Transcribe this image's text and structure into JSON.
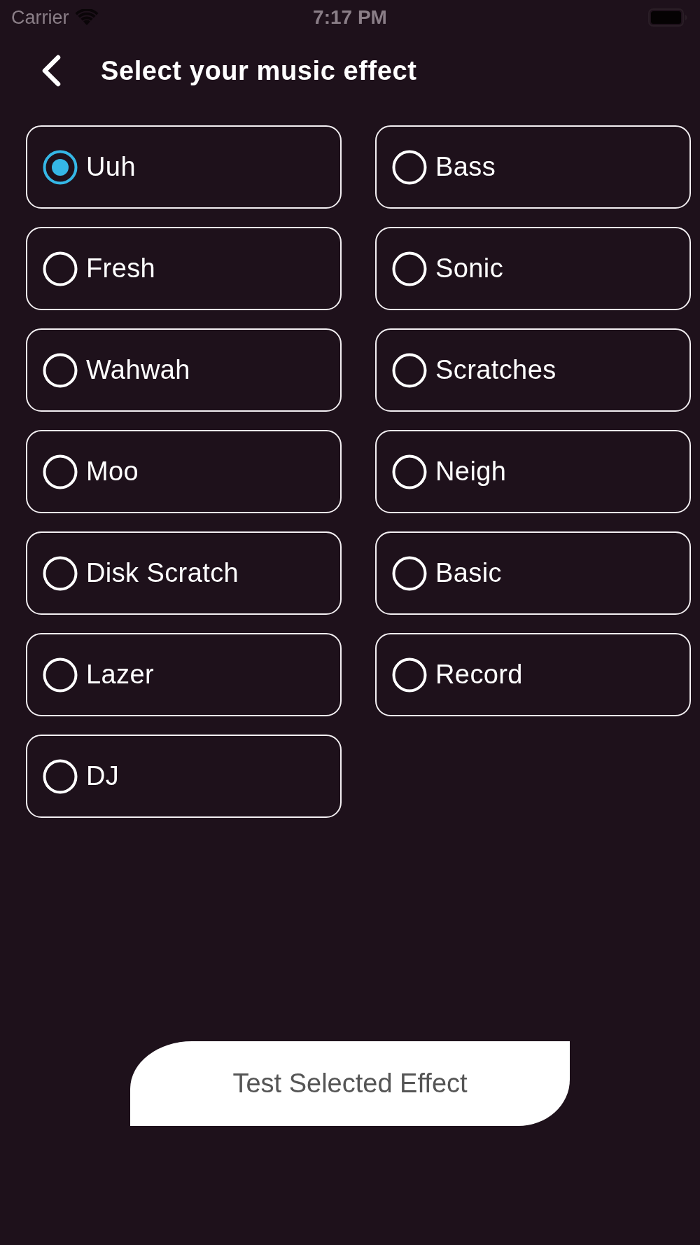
{
  "status_bar": {
    "carrier": "Carrier",
    "time": "7:17 PM"
  },
  "header": {
    "title": "Select your music effect"
  },
  "effects": [
    {
      "label": "Uuh",
      "selected": true
    },
    {
      "label": "Bass",
      "selected": false
    },
    {
      "label": "Fresh",
      "selected": false
    },
    {
      "label": "Sonic",
      "selected": false
    },
    {
      "label": "Wahwah",
      "selected": false
    },
    {
      "label": "Scratches",
      "selected": false
    },
    {
      "label": "Moo",
      "selected": false
    },
    {
      "label": "Neigh",
      "selected": false
    },
    {
      "label": "Disk Scratch",
      "selected": false
    },
    {
      "label": "Basic",
      "selected": false
    },
    {
      "label": "Lazer",
      "selected": false
    },
    {
      "label": "Record",
      "selected": false
    },
    {
      "label": "DJ",
      "selected": false
    }
  ],
  "test_button": {
    "label": "Test Selected Effect"
  }
}
